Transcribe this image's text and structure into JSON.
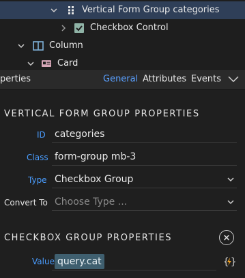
{
  "tree": {
    "items": [
      {
        "label": "Vertical Form Group categories",
        "icon": "grid-dots-icon",
        "selected": true
      },
      {
        "label": "Checkbox Control",
        "icon": "checkbox-icon"
      },
      {
        "label": "Column",
        "icon": "column-layout-icon"
      },
      {
        "label": "Card",
        "icon": "card-icon"
      }
    ]
  },
  "tabs": {
    "truncated_title": "perties",
    "items": [
      "General",
      "Attributes",
      "Events"
    ],
    "active": "General"
  },
  "sections": {
    "vertical_form_group": {
      "title": "VERTICAL FORM GROUP PROPERTIES",
      "fields": {
        "id": {
          "label": "ID",
          "value": "categories"
        },
        "class": {
          "label": "Class",
          "value": "form-group mb-3"
        },
        "type": {
          "label": "Type",
          "value": "Checkbox Group"
        },
        "convert_to": {
          "label": "Convert To",
          "placeholder": "Choose Type ..."
        }
      }
    },
    "checkbox_group": {
      "title": "CHECKBOX GROUP PROPERTIES",
      "fields": {
        "value": {
          "label": "Value",
          "value": "query.cat"
        }
      }
    }
  },
  "colors": {
    "accent": "#4a9dff",
    "selected_row": "#2f3f58",
    "background": "#1e1e1e",
    "pill": "#3f5f6f"
  }
}
